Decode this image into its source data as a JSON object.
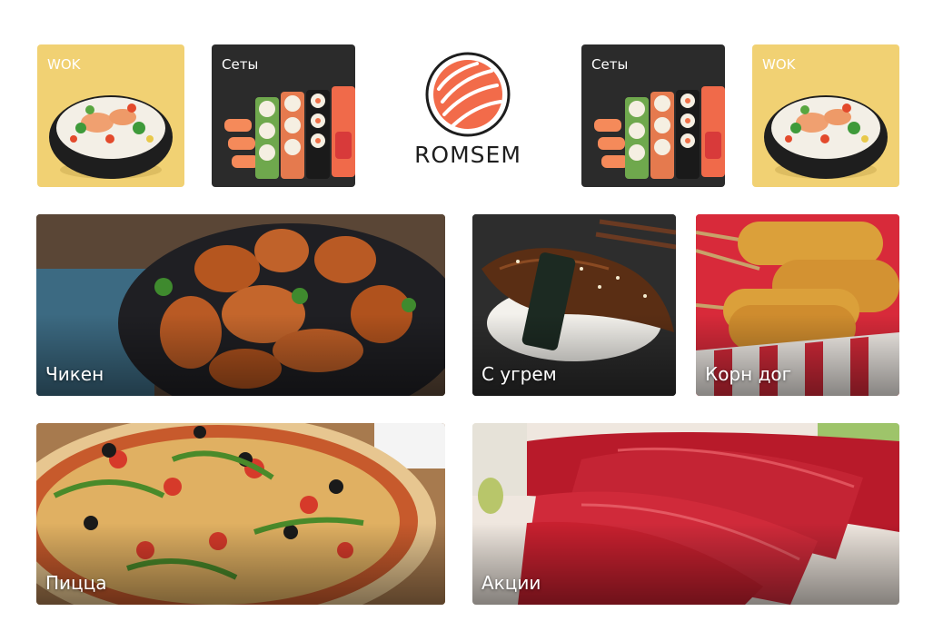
{
  "brand": {
    "name": "ROMSEM",
    "logo_icon": "salmon-roll-icon",
    "accent_color": "#f26b4a"
  },
  "top_row": [
    {
      "label": "WOK",
      "background": "#f1d173",
      "image": "wok-bowl-image"
    },
    {
      "label": "Сеты",
      "background": "#2b2b2b",
      "image": "sushi-set-image"
    },
    {
      "label": "Сеты",
      "background": "#2b2b2b",
      "image": "sushi-set-image"
    },
    {
      "label": "WOK",
      "background": "#f1d173",
      "image": "wok-bowl-image"
    }
  ],
  "categories": [
    {
      "label": "Чикен",
      "image": "fried-chicken-image"
    },
    {
      "label": "С угрем",
      "image": "eel-nigiri-image"
    },
    {
      "label": "Корн дог",
      "image": "corn-dog-image"
    },
    {
      "label": "Пицца",
      "image": "pizza-image"
    },
    {
      "label": "Акции",
      "image": "tuna-sashimi-image"
    }
  ]
}
